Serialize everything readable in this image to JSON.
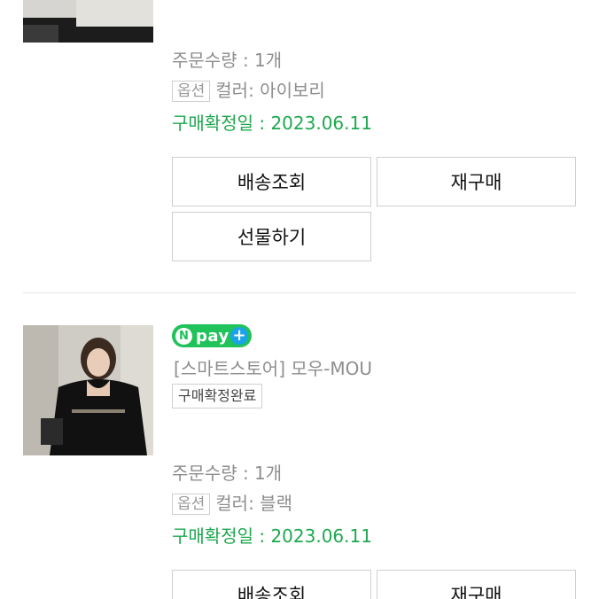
{
  "order1": {
    "quantity": "주문수량 : 1개",
    "option_tag": "옵션",
    "option_value": "컬러: 아이보리",
    "confirm_date": "구매확정일 : 2023.06.11",
    "buttons": {
      "shipping": "배송조회",
      "repurchase": "재구매",
      "gift": "선물하기"
    }
  },
  "order2": {
    "pay_badge": {
      "text": "pay",
      "n": "N",
      "plus": "+"
    },
    "store": "[스마트스토어] 모우-MOU",
    "status": "구매확정완료",
    "quantity": "주문수량 : 1개",
    "option_tag": "옵션",
    "option_value": "컬러: 블랙",
    "confirm_date": "구매확정일 : 2023.06.11",
    "buttons": {
      "shipping": "배송조회",
      "repurchase": "재구매"
    }
  },
  "colors": {
    "confirm_green": "#1ea84f",
    "npay_green": "#20c25a",
    "npay_plus_blue": "#1aa3e8"
  }
}
